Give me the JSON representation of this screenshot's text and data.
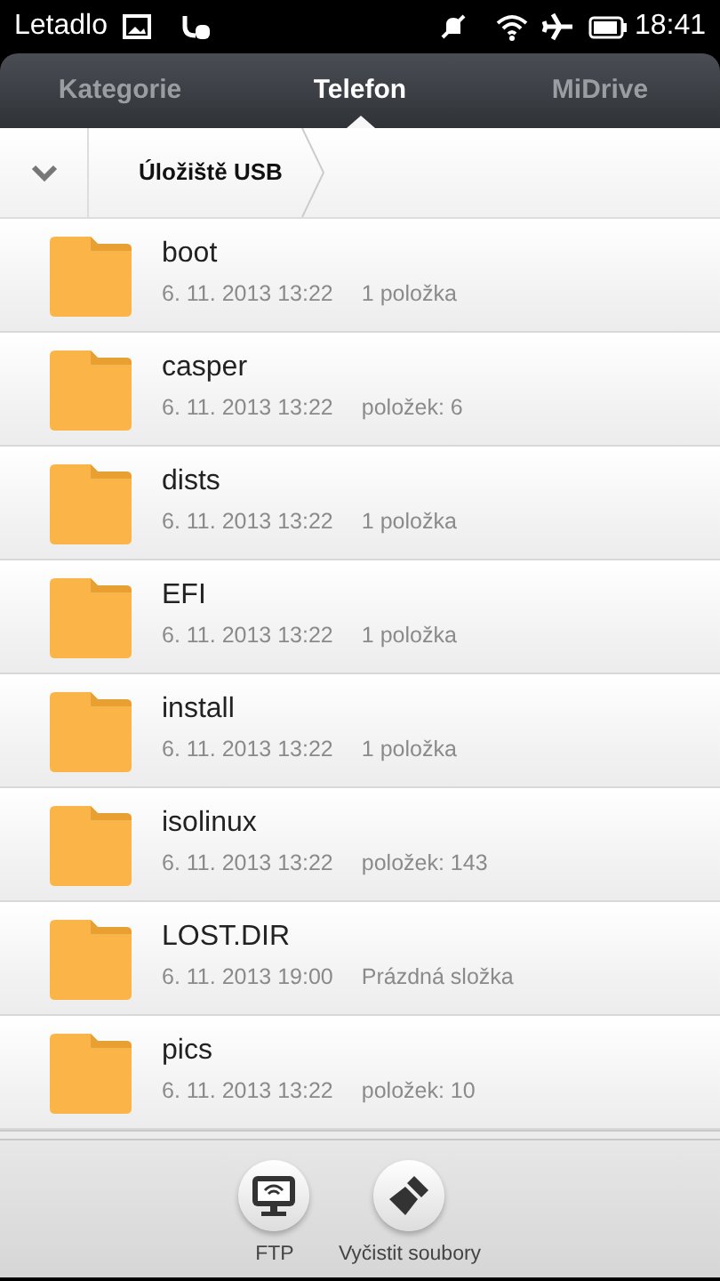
{
  "status_bar": {
    "carrier": "Letadlo",
    "time": "18:41"
  },
  "tabs": [
    {
      "label": "Kategorie",
      "selected": false
    },
    {
      "label": "Telefon",
      "selected": true
    },
    {
      "label": "MiDrive",
      "selected": false
    }
  ],
  "breadcrumb": {
    "path": "Úložiště USB"
  },
  "folders": [
    {
      "name": "boot",
      "date": "6. 11. 2013 13:22",
      "info": "1 položka"
    },
    {
      "name": "casper",
      "date": "6. 11. 2013 13:22",
      "info": "položek: 6"
    },
    {
      "name": "dists",
      "date": "6. 11. 2013 13:22",
      "info": "1 položka"
    },
    {
      "name": "EFI",
      "date": "6. 11. 2013 13:22",
      "info": "1 položka"
    },
    {
      "name": "install",
      "date": "6. 11. 2013 13:22",
      "info": "1 položka"
    },
    {
      "name": "isolinux",
      "date": "6. 11. 2013 13:22",
      "info": "položek: 143"
    },
    {
      "name": "LOST.DIR",
      "date": "6. 11. 2013 19:00",
      "info": "Prázdná složka"
    },
    {
      "name": "pics",
      "date": "6. 11. 2013 13:22",
      "info": "položek: 10"
    }
  ],
  "toolbar": [
    {
      "label": "FTP",
      "kind": "ftp"
    },
    {
      "label": "Vyčistit soubory",
      "kind": "clean"
    }
  ]
}
